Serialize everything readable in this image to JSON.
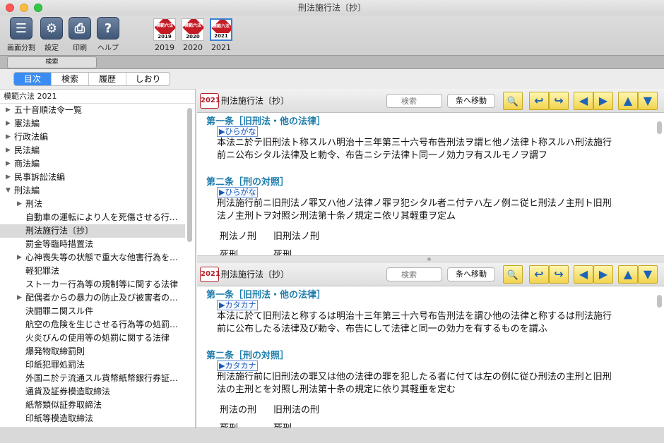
{
  "window": {
    "title": "刑法施行法〔抄〕"
  },
  "toolbar": {
    "buttons": [
      {
        "label": "画面分割",
        "icon": "split-screen-icon",
        "glyph": "☰"
      },
      {
        "label": "設定",
        "icon": "gear-icon",
        "glyph": "⚙"
      },
      {
        "label": "印刷",
        "icon": "printer-icon",
        "glyph": "⎙"
      },
      {
        "label": "ヘルプ",
        "icon": "help-icon",
        "glyph": "?"
      }
    ],
    "books": [
      {
        "year": "2019",
        "cover_text": "模範六法",
        "cover_year": "2019"
      },
      {
        "year": "2020",
        "cover_text": "模範六法",
        "cover_year": "2020"
      },
      {
        "year": "2021",
        "cover_text": "模範六法",
        "cover_year": "2021"
      }
    ]
  },
  "search_tab": {
    "label": "検索"
  },
  "segments": [
    "目次",
    "検索",
    "履歴",
    "しおり"
  ],
  "sidebar": {
    "header": "模範六法 2021",
    "items": [
      {
        "label": "五十音順法令一覧",
        "arrow": "▶"
      },
      {
        "label": "憲法編",
        "arrow": "▶"
      },
      {
        "label": "行政法編",
        "arrow": "▶"
      },
      {
        "label": "民法編",
        "arrow": "▶"
      },
      {
        "label": "商法編",
        "arrow": "▶"
      },
      {
        "label": "民事訴訟法編",
        "arrow": "▶"
      },
      {
        "label": "刑法編",
        "arrow": "▼"
      },
      {
        "label": "刑法",
        "arrow": "▶"
      },
      {
        "label": "自動車の運転により人を死傷させる行…",
        "arrow": ""
      },
      {
        "label": "刑法施行法〔抄〕",
        "arrow": ""
      },
      {
        "label": "罰金等臨時措置法",
        "arrow": ""
      },
      {
        "label": "心神喪失等の状態で重大な他害行為を…",
        "arrow": "▶"
      },
      {
        "label": "軽犯罪法",
        "arrow": ""
      },
      {
        "label": "ストーカー行為等の規制等に関する法律",
        "arrow": ""
      },
      {
        "label": "配偶者からの暴力の防止及び被害者の…",
        "arrow": "▶"
      },
      {
        "label": "決闘罪ニ関スル件",
        "arrow": ""
      },
      {
        "label": "航空の危険を生じさせる行為等の処罰…",
        "arrow": ""
      },
      {
        "label": "火炎びんの使用等の処罰に関する法律",
        "arrow": ""
      },
      {
        "label": "爆発物取締罰則",
        "arrow": ""
      },
      {
        "label": "印紙犯罪処罰法",
        "arrow": ""
      },
      {
        "label": "外国ニ於テ流通スル貨幣紙幣銀行券証…",
        "arrow": ""
      },
      {
        "label": "通貨及証券模造取締法",
        "arrow": ""
      },
      {
        "label": "紙幣類似証券取締法",
        "arrow": ""
      },
      {
        "label": "印紙等模造取締法",
        "arrow": ""
      }
    ]
  },
  "panes": [
    {
      "year_badge": "2021",
      "title": "刑法施行法〔抄〕",
      "search_placeholder": "検索",
      "jump_label": "条へ移動",
      "articles": [
        {
          "heading": "第一条［旧刑法・他の法律］",
          "toggle": "▶ひらがな",
          "lines": [
            "本法ニ於テ旧刑法ト称スルハ明治十三年第三十六号布告刑法ヲ謂ヒ他ノ法律ト称スルハ刑法施行",
            "前ニ公布シタル法律及ヒ勅令、布告ニシテ法律ト同一ノ効力ヲ有スルモノヲ謂フ"
          ]
        },
        {
          "heading": "第二条［刑の対照］",
          "toggle": "▶ひらがな",
          "lines": [
            "刑法施行前ニ旧刑法ノ罪又ハ他ノ法律ノ罪ヲ犯シタル者ニ付テハ左ノ例ニ従ヒ刑法ノ主刑ト旧刑",
            "法ノ主刑トヲ対照シ刑法第十条ノ規定ニ依リ其軽重ヲ定ム"
          ]
        }
      ],
      "table_head": [
        "刑法ノ刑",
        "旧刑法ノ刑"
      ],
      "table_next": [
        "死刑",
        "死刑"
      ]
    },
    {
      "year_badge": "2021",
      "title": "刑法施行法〔抄〕",
      "search_placeholder": "検索",
      "jump_label": "条へ移動",
      "articles": [
        {
          "heading": "第一条［旧刑法・他の法律］",
          "toggle": "▶カタカナ",
          "lines": [
            "本法に於て旧刑法と称するは明治十三年第三十六号布告刑法を謂ひ他の法律と称するは刑法施行",
            "前に公布したる法律及び勅令、布告にして法律と同一の効力を有するものを謂ふ"
          ]
        },
        {
          "heading": "第二条［刑の対照］",
          "toggle": "▶カタカナ",
          "lines": [
            "刑法施行前に旧刑法の罪又は他の法律の罪を犯したる者に付ては左の例に従ひ刑法の主刑と旧刑",
            "法の主刑とを対照し刑法第十条の規定に依り其軽重を定む"
          ]
        }
      ],
      "table_head": [
        "刑法の刑",
        "旧刑法の刑"
      ],
      "table_next": [
        "死刑",
        "死刑"
      ]
    }
  ],
  "nav_glyphs": {
    "search": "🔍",
    "back": "↩",
    "forward": "↪",
    "prev_page": "◀",
    "next_page": "▶",
    "up": "▲",
    "down": "▼"
  }
}
